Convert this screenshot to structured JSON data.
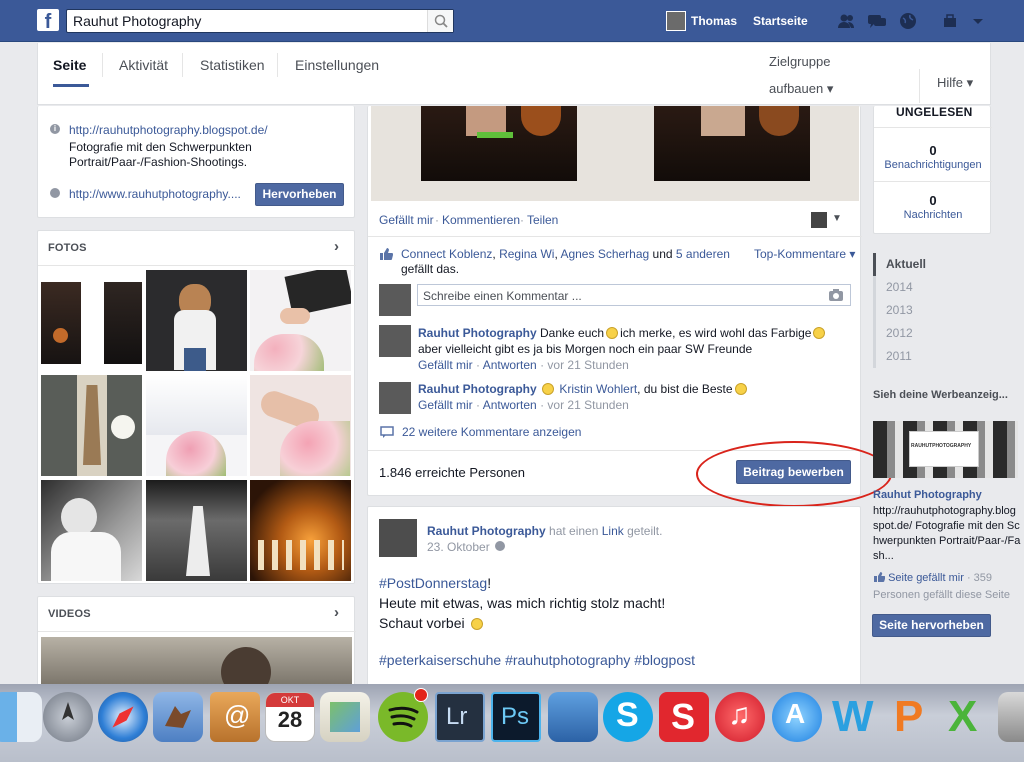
{
  "topbar": {
    "logo": "f",
    "search_value": "Rauhut Photography",
    "profile_name": "Thomas",
    "home_label": "Startseite"
  },
  "tabs": {
    "items": [
      "Seite",
      "Aktivität",
      "Statistiken",
      "Einstellungen"
    ],
    "zielgruppe_line1": "Zielgruppe",
    "zielgruppe_line2": "aufbauen ▾",
    "help": "Hilfe ▾"
  },
  "about": {
    "url1": "http://rauhutphotography.blogspot.de/",
    "desc": "Fotografie mit den Schwerpunkten Portrait/Paar-/Fashion-Shootings.",
    "url2": "http://www.rauhutphotography....",
    "highlight_button": "Hervorheben"
  },
  "photos": {
    "title": "FOTOS",
    "arrow": "›"
  },
  "videos": {
    "title": "VIDEOS",
    "arrow": "›"
  },
  "post": {
    "actions": [
      "Gefällt mir",
      "Kommentieren",
      "Teilen"
    ],
    "likes_names": [
      "Connect Koblenz",
      "Regina Wi",
      "Agnes Scherhag"
    ],
    "likes_and": "und",
    "likes_others": "5 anderen",
    "likes_suffix": "gefällt das.",
    "top_comments": "Top-Kommentare ▾",
    "comment_placeholder": "Schreibe einen Kommentar ...",
    "comments": [
      {
        "author": "Rauhut Photography",
        "text_a": "Danke euch",
        "text_b": "ich merke, es wird wohl das Farbige",
        "text_c": "aber vielleicht gibt es ja bis Morgen noch ein paar SW Freunde",
        "like": "Gefällt mir",
        "reply": "Antworten",
        "time": "vor 21 Stunden"
      },
      {
        "author": "Rauhut Photography",
        "tagged": "Kristin Wohlert",
        "text": ", du bist die Beste",
        "like": "Gefällt mir",
        "reply": "Antworten",
        "time": "vor 21 Stunden"
      }
    ],
    "more_comments": "22 weitere Kommentare anzeigen",
    "reach": "1.846 erreichte Personen",
    "boost_button": "Beitrag bewerben"
  },
  "post2": {
    "author": "Rauhut Photography",
    "shared_prefix": "hat einen",
    "shared_link": "Link",
    "shared_suffix": "geteilt.",
    "date": "23. Oktober",
    "hashtag1": "#PostDonnerstag",
    "line1_suffix": "!",
    "line2": "Heute mit etwas, was mich richtig stolz macht!",
    "line3": "Schaut vorbei",
    "tags": "#peterkaiserschuhe #rauhutphotography #blogpost"
  },
  "right": {
    "unread_title": "UNGELESEN",
    "notifications_count": "0",
    "notifications_label": "Benachrichtigungen",
    "messages_count": "0",
    "messages_label": "Nachrichten",
    "years": [
      "Aktuell",
      "2014",
      "2013",
      "2012",
      "2011"
    ],
    "ad_title": "Sieh deine Werbeanzeig...",
    "ad_image_text": "RAUHUTPHOTOGRAPHY",
    "ad_page": "Rauhut Photography",
    "ad_text": "http://rauhutphotography.blogspot.de/ Fotografie mit den Schwerpunkten Portrait/Paar-/Fash...",
    "ad_like": "Seite gefällt mir",
    "ad_like_count": "· 359",
    "ad_people": "Personen gefällt diese Seite",
    "promote_button": "Seite hervorheben"
  },
  "dock": {
    "calendar_month": "OKT",
    "calendar_day": "28",
    "lr": "Lr",
    "ps": "Ps",
    "w": "W",
    "p": "P",
    "x": "X"
  },
  "colors": {
    "facebook_blue": "#3b5998",
    "button_blue": "#4e69a2",
    "highlight_circle": "#d9241b"
  }
}
